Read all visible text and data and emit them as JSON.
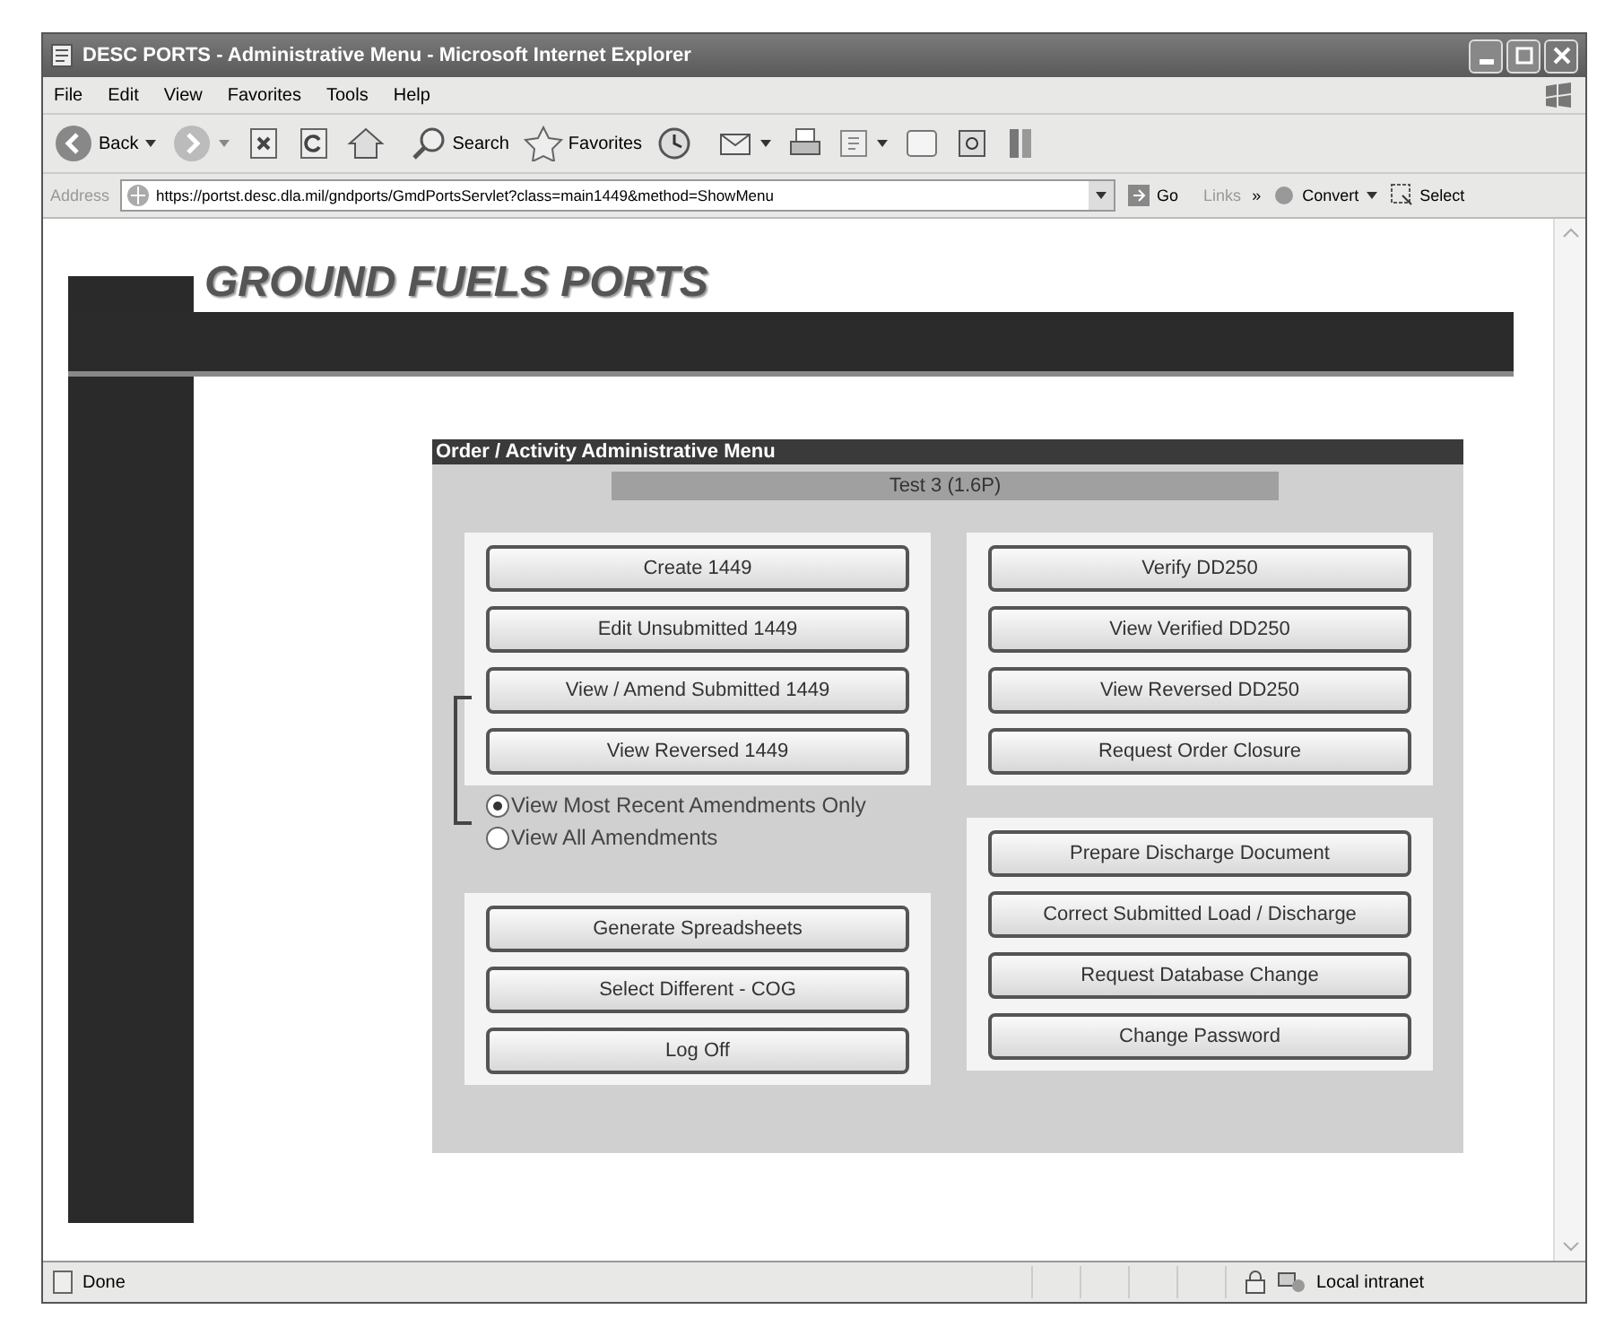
{
  "window": {
    "title": "DESC PORTS - Administrative Menu - Microsoft Internet Explorer"
  },
  "menu_bar": [
    "File",
    "Edit",
    "View",
    "Favorites",
    "Tools",
    "Help"
  ],
  "toolbar": [
    {
      "kind": "back",
      "label": "Back"
    },
    {
      "kind": "forward"
    },
    {
      "kind": "stop"
    },
    {
      "kind": "refresh"
    },
    {
      "kind": "home"
    },
    {
      "kind": "search",
      "label": "Search"
    },
    {
      "kind": "favorites",
      "label": "Favorites"
    },
    {
      "kind": "history"
    },
    {
      "kind": "mail"
    },
    {
      "kind": "print"
    },
    {
      "kind": "edit"
    },
    {
      "kind": "discuss"
    },
    {
      "kind": "research"
    },
    {
      "kind": "messenger"
    }
  ],
  "address_bar": {
    "label": "Address",
    "value": "https://portst.desc.dla.mil/gndports/GmdPortsServlet?class=main1449&method=ShowMenu",
    "go": "Go",
    "links": "Links",
    "links_more": "»",
    "convert": "Convert",
    "select": "Select"
  },
  "page": {
    "logo": "GROUND FUELS PORTS",
    "menu_title": "Order / Activity Administrative Menu",
    "subtitle": "Test 3 (1.6P)",
    "left_top_buttons": [
      "Create 1449",
      "Edit Unsubmitted 1449",
      "View / Amend Submitted 1449",
      "View Reversed 1449"
    ],
    "amendment_options": [
      {
        "label": "View Most Recent Amendments Only",
        "selected": true
      },
      {
        "label": "View All Amendments",
        "selected": false
      }
    ],
    "left_bottom_buttons": [
      "Generate Spreadsheets",
      "Select Different - COG",
      "Log Off"
    ],
    "right_top_buttons": [
      "Verify DD250",
      "View Verified DD250",
      "View Reversed DD250",
      "Request Order Closure"
    ],
    "right_bottom_buttons": [
      "Prepare Discharge Document",
      "Correct Submitted Load / Discharge",
      "Request Database Change",
      "Change Password"
    ]
  },
  "status_bar": {
    "text": "Done",
    "zone": "Local intranet"
  }
}
